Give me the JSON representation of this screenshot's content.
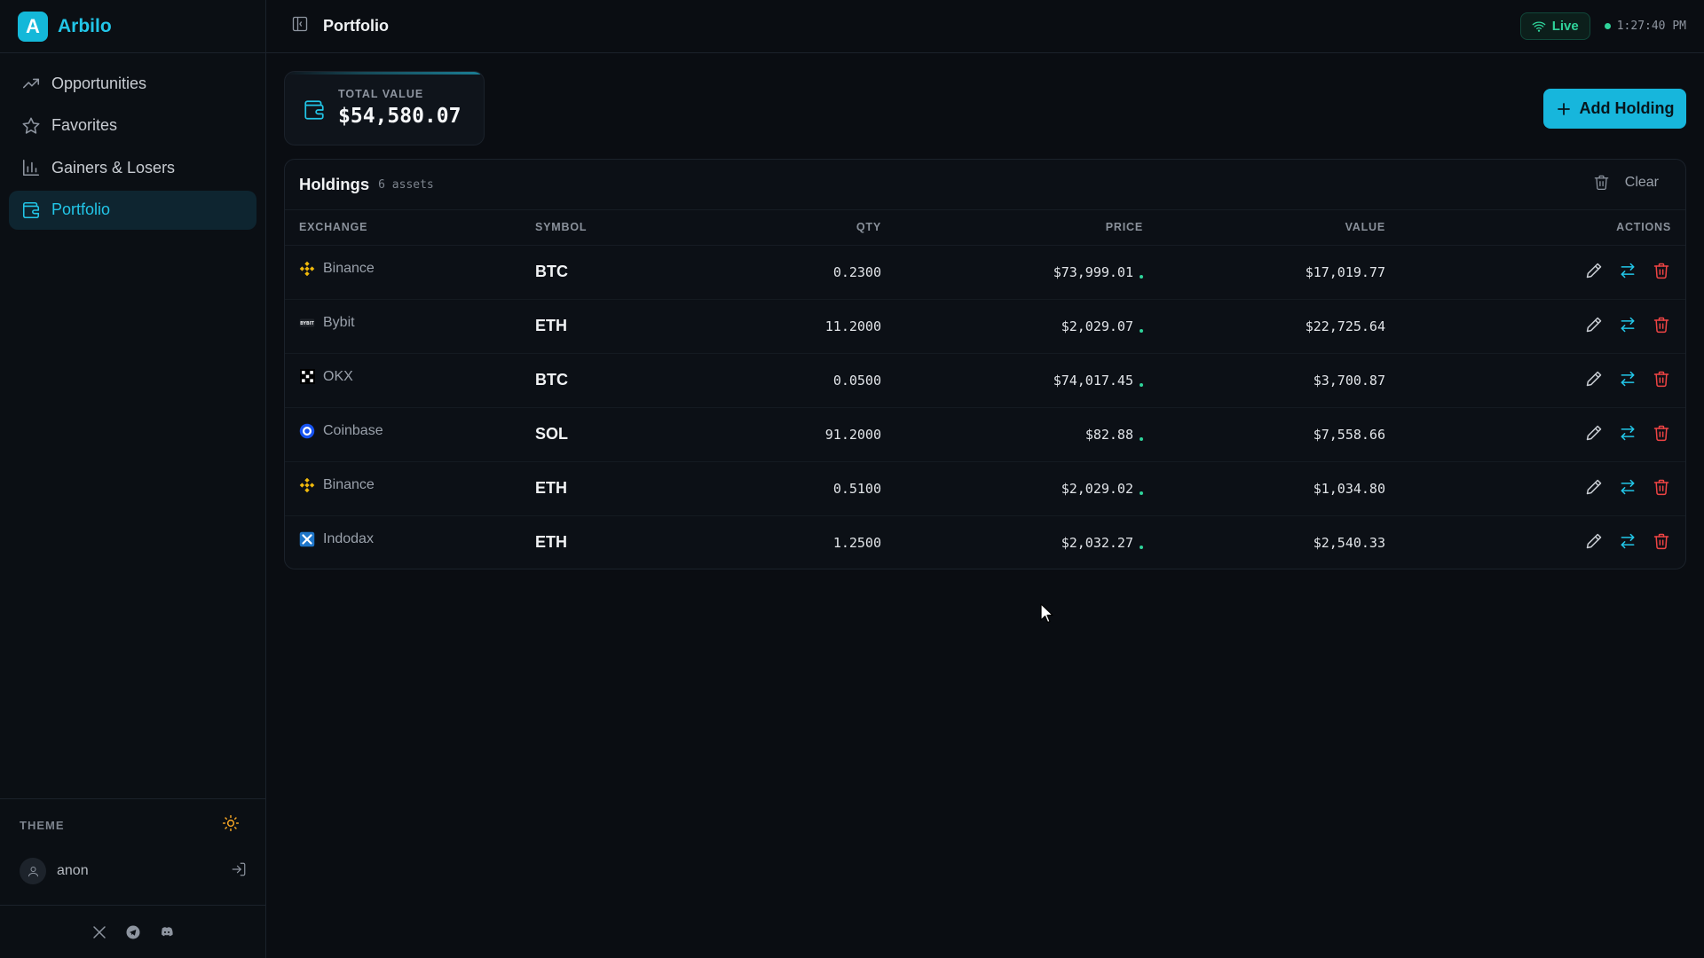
{
  "app": {
    "name": "Arbilo",
    "logo_letter": "A",
    "accent": "#22c6e8"
  },
  "sidebar": {
    "items": [
      {
        "label": "Opportunities",
        "icon": "trending-up-icon"
      },
      {
        "label": "Favorites",
        "icon": "star-icon"
      },
      {
        "label": "Gainers & Losers",
        "icon": "bar-chart-icon"
      },
      {
        "label": "Portfolio",
        "icon": "wallet-icon",
        "active": true
      }
    ],
    "theme_label": "THEME",
    "user": "anon"
  },
  "header": {
    "title": "Portfolio",
    "status": "Live",
    "time": "1:27:40 PM"
  },
  "summary": {
    "total_label": "TOTAL VALUE",
    "total_value": "$54,580.07",
    "add_button": "Add Holding"
  },
  "holdings": {
    "title": "Holdings",
    "count": "6 assets",
    "clear_label": "Clear",
    "columns": [
      "EXCHANGE",
      "SYMBOL",
      "QTY",
      "PRICE",
      "VALUE",
      "ACTIONS"
    ],
    "rows": [
      {
        "exchange": "Binance",
        "symbol": "BTC",
        "qty": "0.2300",
        "price": "$73,999.01",
        "value": "$17,019.77"
      },
      {
        "exchange": "Bybit",
        "symbol": "ETH",
        "qty": "11.2000",
        "price": "$2,029.07",
        "value": "$22,725.64"
      },
      {
        "exchange": "OKX",
        "symbol": "BTC",
        "qty": "0.0500",
        "price": "$74,017.45",
        "value": "$3,700.87"
      },
      {
        "exchange": "Coinbase",
        "symbol": "SOL",
        "qty": "91.2000",
        "price": "$82.88",
        "value": "$7,558.66"
      },
      {
        "exchange": "Binance",
        "symbol": "ETH",
        "qty": "0.5100",
        "price": "$2,029.02",
        "value": "$1,034.80"
      },
      {
        "exchange": "Indodax",
        "symbol": "ETH",
        "qty": "1.2500",
        "price": "$2,032.27",
        "value": "$2,540.33"
      }
    ]
  }
}
